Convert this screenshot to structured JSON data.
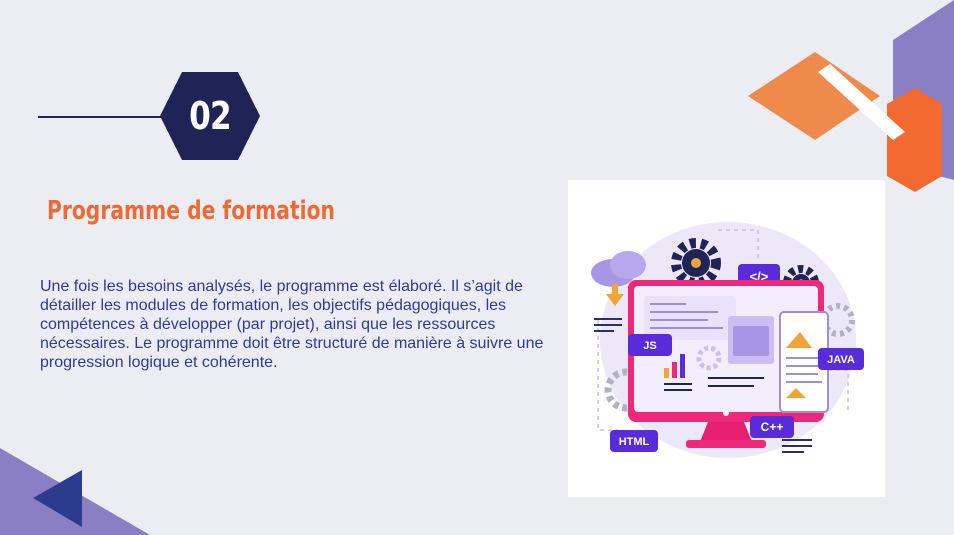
{
  "slide": {
    "number": "02",
    "title": "Programme de formation",
    "body": "Une fois les besoins analysés, le programme est élaboré. Il s’agit de détailler les modules de formation, les objectifs pédagogiques, les compétences à développer (par projet), ainsi que les ressources nécessaires. Le programme doit être structuré de manière à suivre une progression logique et cohérente."
  },
  "illustration": {
    "tags": {
      "code": "</>",
      "js": "JS",
      "java": "JAVA",
      "html": "HTML",
      "cpp": "C++"
    }
  },
  "colors": {
    "background": "#ecedf2",
    "navy": "#1f2356",
    "accent_orange": "#ee6a35",
    "body_text": "#2f3a9c",
    "lavender": "#8a7fc4",
    "blue_triangle": "#2b3c8e",
    "monitor_pink": "#f0287a",
    "tag_purple": "#5a2bd8"
  },
  "icons": [
    "hexagon-badge",
    "gear-icon",
    "cloud-download-icon",
    "monitor-icon",
    "chart-icon"
  ]
}
